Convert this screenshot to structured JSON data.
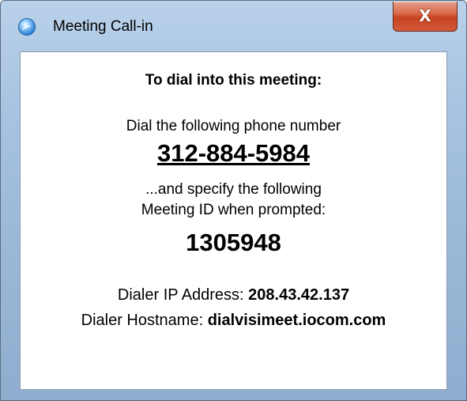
{
  "window": {
    "title": "Meeting Call-in",
    "close_label": "X"
  },
  "icons": {
    "app": "app-globe-icon",
    "close": "close-icon"
  },
  "content": {
    "heading": "To dial into this meeting:",
    "dial_intro": "Dial the following phone number",
    "phone_number": "312-884-5984",
    "specify_line": "...and specify the following",
    "prompted_line": "Meeting ID when prompted:",
    "meeting_id": "1305948",
    "ip_label": "Dialer IP Address: ",
    "ip_value": "208.43.42.137",
    "host_label": "Dialer Hostname: ",
    "host_value": "dialvisimeet.iocom.com"
  },
  "colors": {
    "title_bar": "#a6c2e0",
    "close_button": "#c6431f"
  }
}
